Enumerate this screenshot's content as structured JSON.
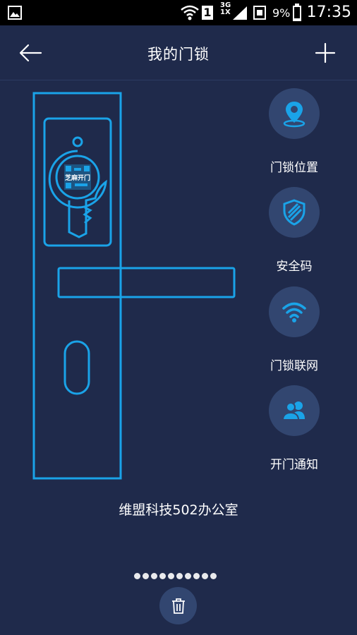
{
  "status_bar": {
    "sim_number": "1",
    "network_top": "3G",
    "network_bottom": "1X",
    "battery_percent": "9%",
    "time": "17:35"
  },
  "header": {
    "title": "我的门锁",
    "back_icon": "arrow-left-icon",
    "add_icon": "plus-icon"
  },
  "lock_illustration": {
    "qr_label": "芝麻开门"
  },
  "actions": [
    {
      "label": "门锁位置",
      "icon": "location-pin-icon"
    },
    {
      "label": "安全码",
      "icon": "shield-icon"
    },
    {
      "label": "门锁联网",
      "icon": "wifi-icon"
    },
    {
      "label": "开门通知",
      "icon": "users-icon"
    }
  ],
  "lock_name": "维盟科技502办公室",
  "pager": {
    "total": 10,
    "current": 1
  },
  "delete_icon": "trash-icon",
  "colors": {
    "background": "#1f2a4b",
    "accent": "#1aa3e8",
    "circle_bg": "#324670",
    "status_bar": "#000000"
  }
}
